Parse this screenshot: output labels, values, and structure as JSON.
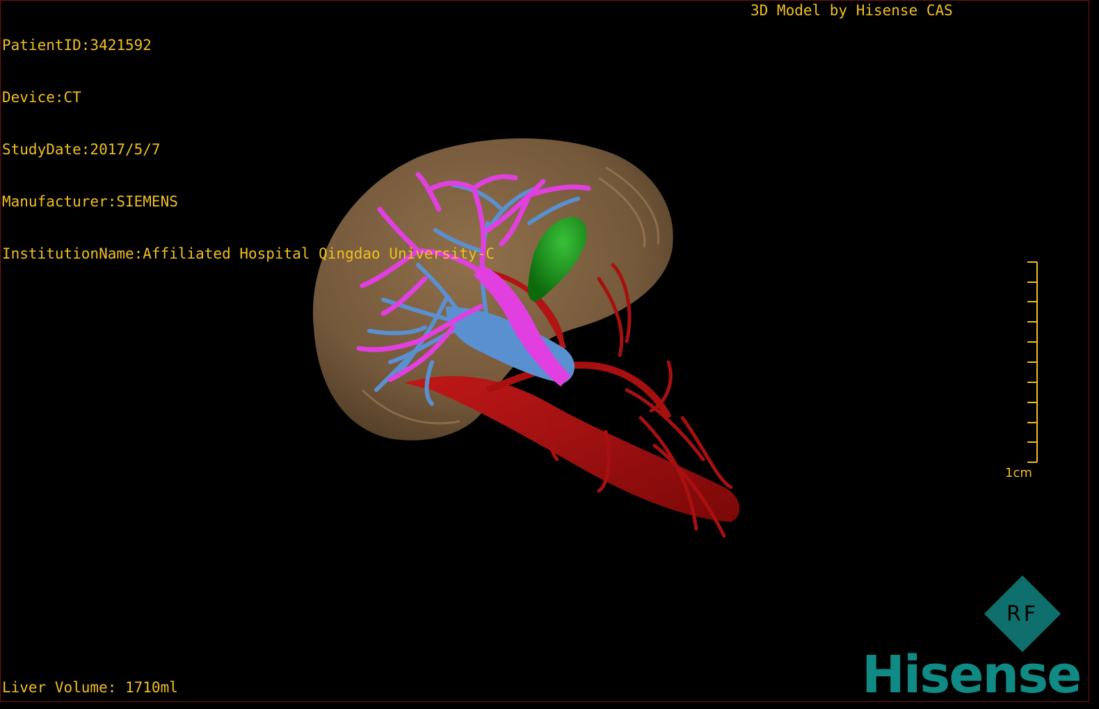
{
  "patient": {
    "id_line": "PatientID:3421592",
    "device_line": "Device:CT",
    "study_date_line": "StudyDate:2017/5/7",
    "manufacturer_line": "Manufacturer:SIEMENS",
    "institution_line": "InstitutionName:Affiliated Hospital Qingdao University-C"
  },
  "credit": "3D Model by Hisense CAS",
  "liver_volume": "Liver Volume: 1710ml",
  "scale": {
    "label": "1cm"
  },
  "logo": {
    "badge_text": "RF",
    "brand": "Hisense"
  },
  "colors": {
    "overlay_text": "#f0c020",
    "liver": "#8a6a45",
    "portal_vein": "#e040e0",
    "hepatic_vein": "#5a90d0",
    "artery": "#a81010",
    "gallbladder": "#1a9a1a",
    "brand": "#0f8a84"
  }
}
